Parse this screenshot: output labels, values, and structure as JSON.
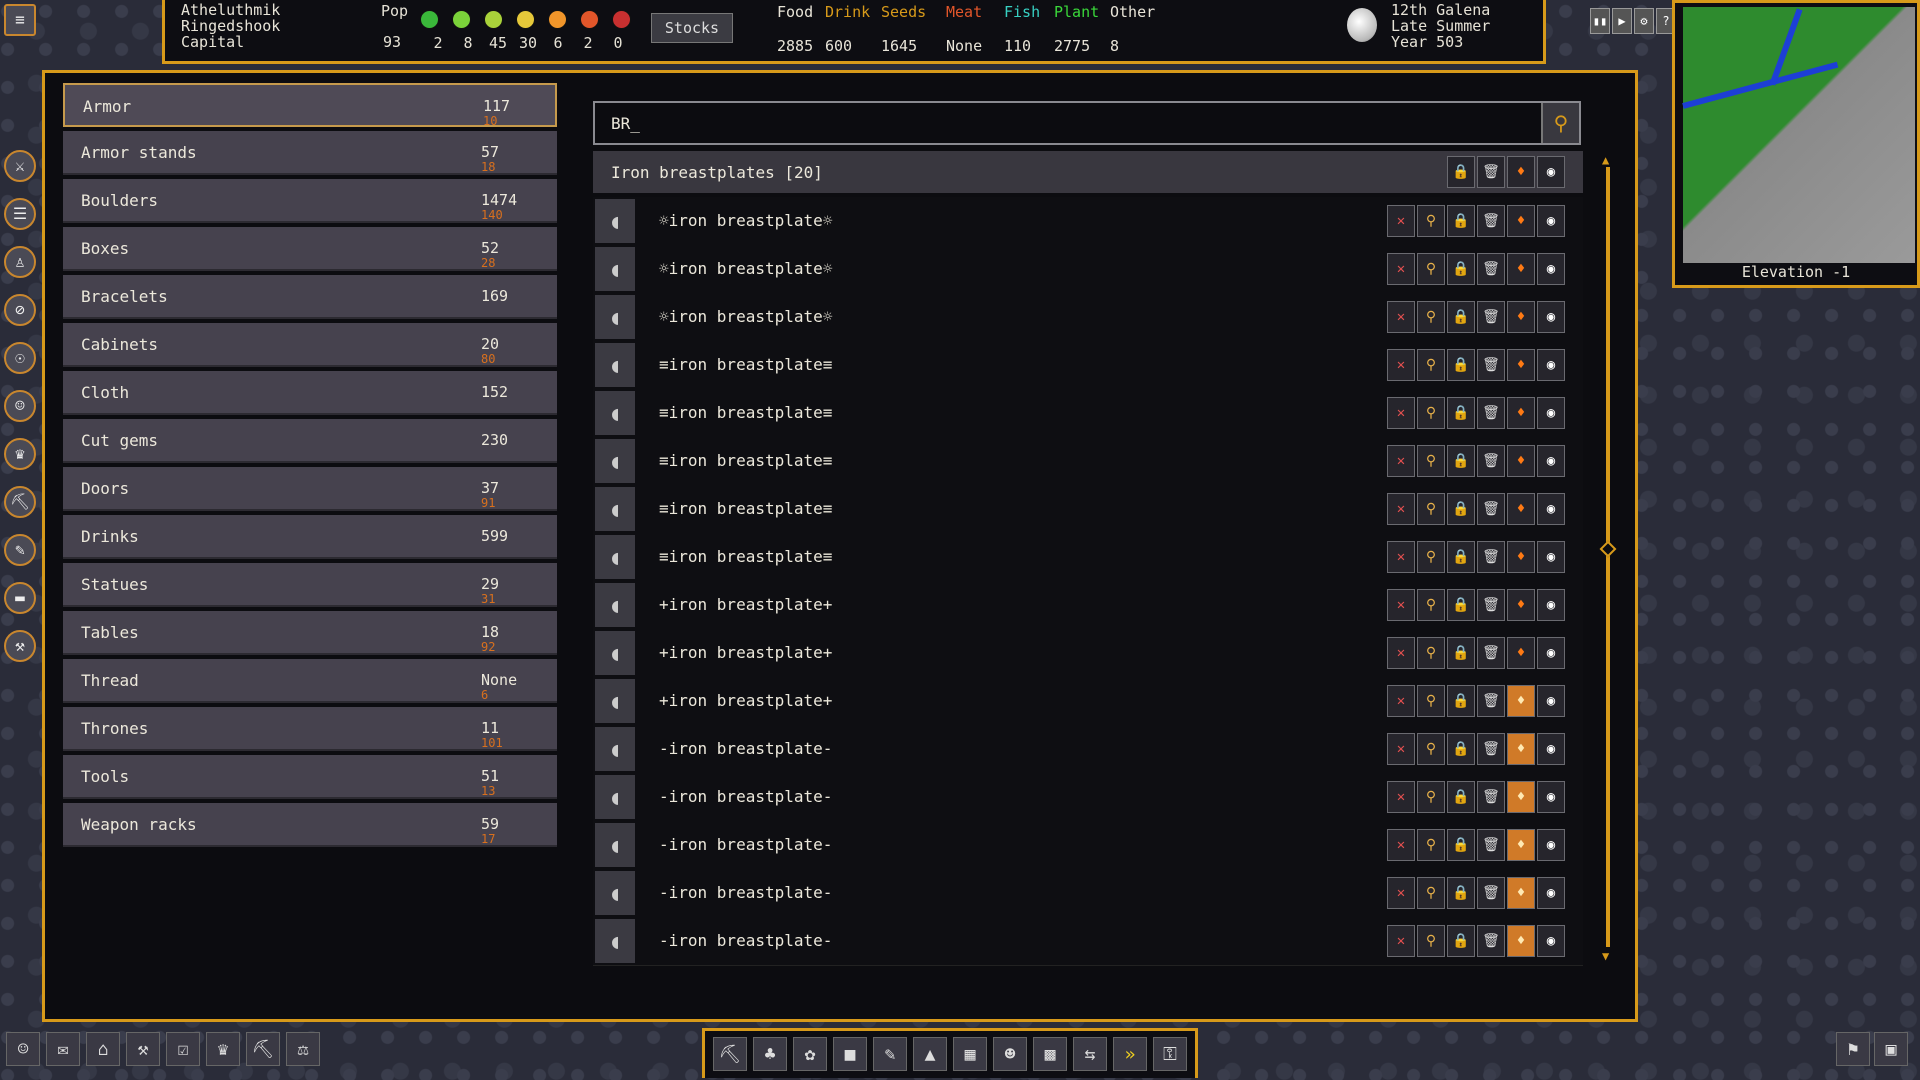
{
  "topbar": {
    "fortress": [
      "Atheluthmik",
      "Ringedshook",
      "Capital"
    ],
    "pop_label": "Pop",
    "pop_value": "93",
    "happiness_values": [
      "2",
      "8",
      "45",
      "30",
      "6",
      "2",
      "0"
    ],
    "happiness_colors": [
      "#3ab83a",
      "#7bd23a",
      "#a9d23a",
      "#e5c83a",
      "#f0952a",
      "#e2562a",
      "#c83030"
    ],
    "stocks_label": "Stocks",
    "resources": [
      {
        "label": "Food",
        "value": "2885",
        "color": "#e8e4d8"
      },
      {
        "label": "Drink",
        "value": "600",
        "color": "#d79a1a"
      },
      {
        "label": "Seeds",
        "value": "1645",
        "color": "#d79a1a"
      },
      {
        "label": "Meat",
        "value": "None",
        "color": "#e2562a"
      },
      {
        "label": "Fish",
        "value": "110",
        "color": "#37d0c2"
      },
      {
        "label": "Plant",
        "value": "2775",
        "color": "#3ad83a"
      },
      {
        "label": "Other",
        "value": "8",
        "color": "#e8e4d8"
      }
    ],
    "date": [
      "12th Galena",
      "Late Summer",
      "Year 503"
    ]
  },
  "minimap": {
    "elevation": "Elevation -1"
  },
  "categories": [
    {
      "name": "Armor",
      "count": "117",
      "sub": "10",
      "active": true
    },
    {
      "name": "Armor stands",
      "count": "57",
      "sub": "18"
    },
    {
      "name": "Boulders",
      "count": "1474",
      "sub": "140"
    },
    {
      "name": "Boxes",
      "count": "52",
      "sub": "28"
    },
    {
      "name": "Bracelets",
      "count": "169",
      "sub": ""
    },
    {
      "name": "Cabinets",
      "count": "20",
      "sub": "80"
    },
    {
      "name": "Cloth",
      "count": "152",
      "sub": ""
    },
    {
      "name": "Cut gems",
      "count": "230",
      "sub": ""
    },
    {
      "name": "Doors",
      "count": "37",
      "sub": "91"
    },
    {
      "name": "Drinks",
      "count": "599",
      "sub": ""
    },
    {
      "name": "Statues",
      "count": "29",
      "sub": "31"
    },
    {
      "name": "Tables",
      "count": "18",
      "sub": "92"
    },
    {
      "name": "Thread",
      "count": "None",
      "sub": "6"
    },
    {
      "name": "Thrones",
      "count": "11",
      "sub": "101"
    },
    {
      "name": "Tools",
      "count": "51",
      "sub": "13"
    },
    {
      "name": "Weapon racks",
      "count": "59",
      "sub": "17"
    }
  ],
  "search": {
    "query": "BR_"
  },
  "group": {
    "title": "Iron breastplates [20]"
  },
  "items": [
    {
      "name": "☼iron breastplate☼",
      "fire_on": false
    },
    {
      "name": "☼iron breastplate☼",
      "fire_on": false
    },
    {
      "name": "☼iron breastplate☼",
      "fire_on": false
    },
    {
      "name": "≡iron breastplate≡",
      "fire_on": false
    },
    {
      "name": "≡iron breastplate≡",
      "fire_on": false
    },
    {
      "name": "≡iron breastplate≡",
      "fire_on": false
    },
    {
      "name": "≡iron breastplate≡",
      "fire_on": false
    },
    {
      "name": "≡iron breastplate≡",
      "fire_on": false
    },
    {
      "name": "+iron breastplate+",
      "fire_on": false
    },
    {
      "name": "+iron breastplate+",
      "fire_on": false
    },
    {
      "name": "+iron breastplate+",
      "fire_on": true
    },
    {
      "name": "-iron breastplate-",
      "fire_on": true
    },
    {
      "name": "-iron breastplate-",
      "fire_on": true
    },
    {
      "name": "-iron breastplate-",
      "fire_on": true
    },
    {
      "name": "-iron breastplate-",
      "fire_on": true
    },
    {
      "name": "-iron breastplate-",
      "fire_on": true
    }
  ],
  "icons": {
    "unit": "✕",
    "magnify": "⚲",
    "lock": "🔒",
    "trash": "🗑",
    "fire": "♦",
    "eye": "◉"
  }
}
